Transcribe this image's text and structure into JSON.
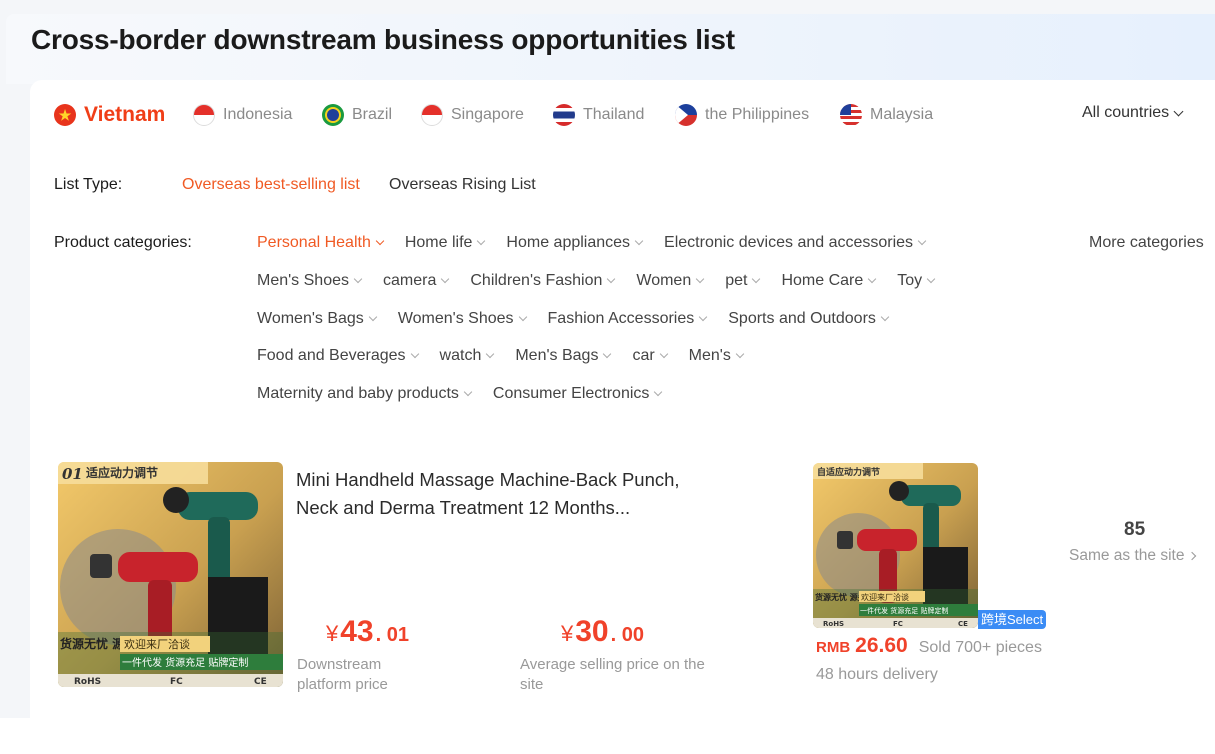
{
  "page": {
    "title": "Cross-border downstream business opportunities list"
  },
  "countries": {
    "items": [
      {
        "label": "Vietnam",
        "flag": "vietnam-flag-icon",
        "active": true
      },
      {
        "label": "Indonesia",
        "flag": "indonesia-flag-icon"
      },
      {
        "label": "Brazil",
        "flag": "brazil-flag-icon"
      },
      {
        "label": "Singapore",
        "flag": "singapore-flag-icon"
      },
      {
        "label": "Thailand",
        "flag": "thailand-flag-icon"
      },
      {
        "label": "the Philippines",
        "flag": "philippines-flag-icon"
      },
      {
        "label": "Malaysia",
        "flag": "malaysia-flag-icon"
      }
    ],
    "all_label": "All countries"
  },
  "list_type": {
    "label": "List Type:",
    "options": [
      "Overseas best-selling list",
      "Overseas Rising List"
    ],
    "selected": "Overseas best-selling list"
  },
  "categories": {
    "label": "Product categories:",
    "rows": [
      [
        "Personal Health",
        "Home life",
        "Home appliances",
        "Electronic devices and accessories"
      ],
      [
        "Men's Shoes",
        "camera",
        "Children's Fashion",
        "Women",
        "pet",
        "Home Care",
        "Toy"
      ],
      [
        "Women's Bags",
        "Women's Shoes",
        "Fashion Accessories",
        "Sports and Outdoors"
      ],
      [
        "Food and Beverages",
        "watch",
        "Men's Bags",
        "car",
        "Men's"
      ],
      [
        "Maternity and baby products",
        "Consumer Electronics"
      ]
    ],
    "selected": "Personal Health",
    "more_label": "More categories"
  },
  "product": {
    "rank": "01",
    "title": "Mini Handheld Massage Machine-Back Punch, Neck and Derma Treatment 12 Months...",
    "image_text": {
      "banner": "适应动力调节",
      "banner_small": "自适应动力调节",
      "left_tag": "货源无忧 源头厂家",
      "welcome": "欢迎来厂洽谈",
      "service": "一件代发 货源充足 贴牌定制",
      "certs": [
        "RoHS",
        "FC",
        "CE"
      ]
    },
    "downstream_price": {
      "currency": "¥",
      "integer": "43",
      "decimal": ". 01",
      "label": "Downstream platform price"
    },
    "avg_price": {
      "currency": "¥",
      "integer": "30",
      "decimal": ". 00",
      "label": "Average selling price on the site"
    },
    "source": {
      "badge": "跨境Select",
      "currency": "RMB",
      "price": "26.60",
      "sold": "Sold 700+ pieces",
      "delivery": "48 hours delivery"
    },
    "same_count": "85",
    "same_label": "Same as the site"
  },
  "colors": {
    "accent": "#f05a24",
    "price": "#f0422a",
    "badge": "#3b8cf5",
    "muted": "#999999"
  }
}
